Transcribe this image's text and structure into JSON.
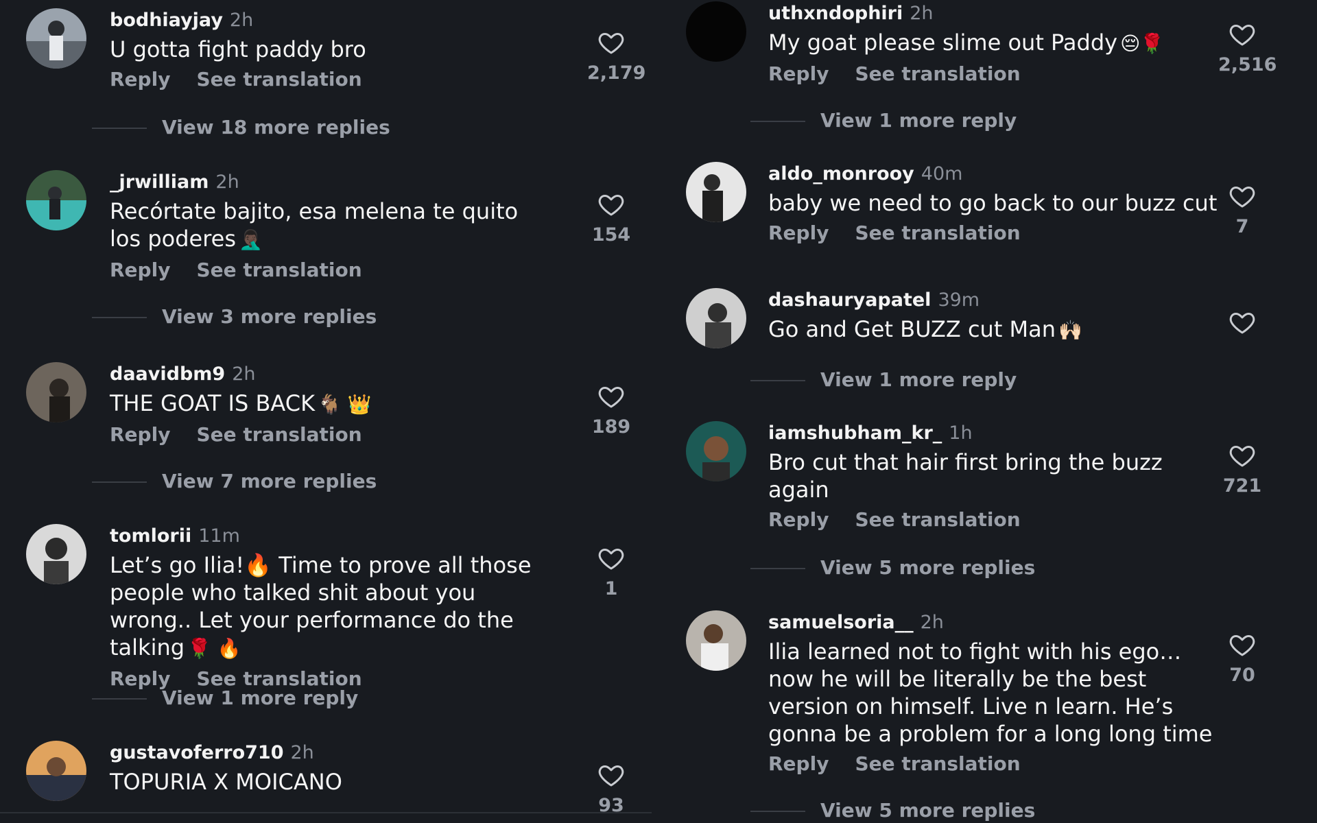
{
  "labels": {
    "reply": "Reply",
    "see_translation": "See translation"
  },
  "left": [
    {
      "username": "bodhiayjay",
      "time": "2h",
      "text": "U gotta fight paddy bro",
      "emoji": "",
      "likes": "2,179",
      "view_replies": "View 18 more replies"
    },
    {
      "username": "_jrwilliam",
      "time": "2h",
      "text": "Recórtate bajito, esa melena te quito los poderes",
      "emoji": "🤦🏿‍♂️",
      "likes": "154",
      "view_replies": "View 3 more replies"
    },
    {
      "username": "daavidbm9",
      "time": "2h",
      "text": "THE GOAT IS BACK",
      "emoji": "🐐 👑",
      "likes": "189",
      "view_replies": "View 7 more replies"
    },
    {
      "username": "tomlorii",
      "time": "11m",
      "text": "Let’s go Ilia!🔥 Time to prove all those people who talked shit about you wrong.. Let your performance do the talking",
      "emoji": "🌹 🔥",
      "likes": "1",
      "view_replies": "View 1 more reply"
    },
    {
      "username": "gustavoferro710",
      "time": "2h",
      "text": "TOPURIA X MOICANO",
      "emoji": "",
      "likes": "93",
      "view_replies": ""
    }
  ],
  "right": [
    {
      "username": "uthxndophiri",
      "time": "2h",
      "text": "My goat please slime out Paddy",
      "emoji": "😔🌹",
      "likes": "2,516",
      "view_replies": "View 1 more reply"
    },
    {
      "username": "aldo_monrooy",
      "time": "40m",
      "text": "baby we need to go back to our buzz cut",
      "emoji": "",
      "likes": "7",
      "view_replies": ""
    },
    {
      "username": "dashauryapatel",
      "time": "39m",
      "text": "Go and Get BUZZ cut Man",
      "emoji": "🙌🏻",
      "likes": "",
      "view_replies": "View 1 more reply"
    },
    {
      "username": "iamshubham_kr_",
      "time": "1h",
      "text": "Bro cut that hair first bring the buzz again",
      "emoji": "",
      "likes": "721",
      "view_replies": "View 5 more replies"
    },
    {
      "username": "samuelsoria__",
      "time": "2h",
      "text": "Ilia learned not to fight with his ego… now he will be literally be the best version on himself. Live n learn. He’s gonna be a problem for a long long time",
      "emoji": "",
      "likes": "70",
      "view_replies": "View 5 more replies"
    }
  ]
}
